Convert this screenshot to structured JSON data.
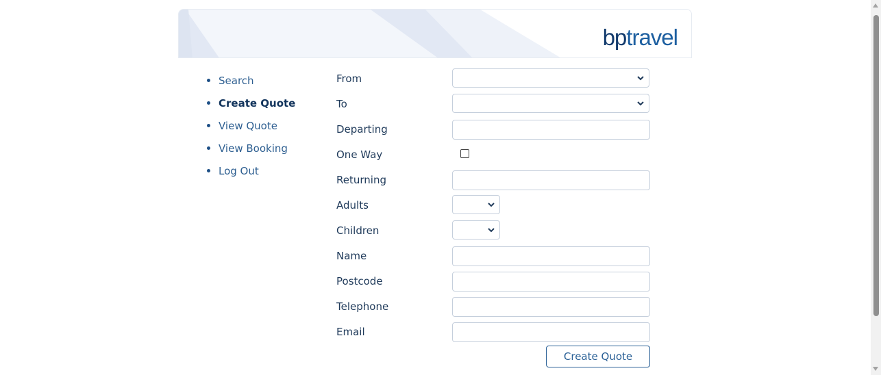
{
  "header": {
    "logo_bp": "bp",
    "logo_travel": "travel"
  },
  "nav": {
    "items": [
      {
        "label": "Search"
      },
      {
        "label": "Create Quote",
        "active": true
      },
      {
        "label": "View Quote"
      },
      {
        "label": "View Booking"
      },
      {
        "label": "Log Out"
      }
    ]
  },
  "form": {
    "from_label": "From",
    "to_label": "To",
    "departing_label": "Departing",
    "one_way_label": "One Way",
    "returning_label": "Returning",
    "adults_label": "Adults",
    "children_label": "Children",
    "name_label": "Name",
    "postcode_label": "Postcode",
    "telephone_label": "Telephone",
    "email_label": "Email",
    "from_value": "",
    "to_value": "",
    "departing_value": "",
    "one_way_checked": false,
    "returning_value": "",
    "adults_value": "",
    "children_value": "",
    "name_value": "",
    "postcode_value": "",
    "telephone_value": "",
    "email_value": "",
    "submit_label": "Create Quote"
  },
  "colors": {
    "accent": "#2a6096",
    "nav_link": "#2e5f91",
    "nav_active": "#12345c",
    "logo": "#1d5fa0"
  },
  "icons": {
    "select_chevron": "chevron-down-icon"
  }
}
